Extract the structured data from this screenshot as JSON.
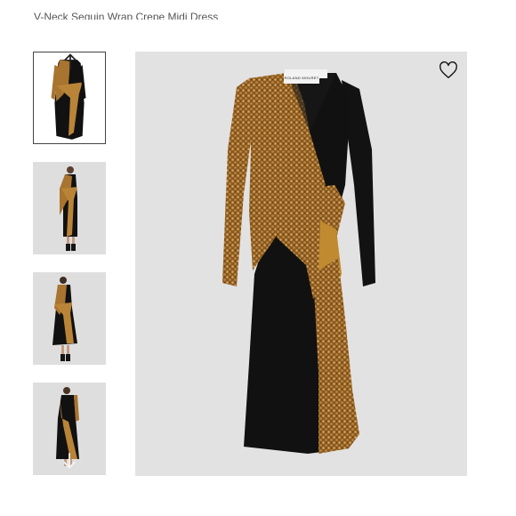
{
  "product": {
    "title": "V-Neck Sequin Wrap Crepe Midi Dress",
    "brand_label": "ROLAND MOURET"
  },
  "gallery": {
    "thumbnail_count": 4,
    "active_index": 0,
    "scroll_up_icon": "arrow-up-icon",
    "scroll_down_icon": "arrow-down-icon"
  },
  "actions": {
    "wishlist_icon": "heart-outline-icon"
  },
  "colors": {
    "sequin_gold": "#a8742f",
    "dress_black": "#111111",
    "backdrop": "#e2e2e2"
  }
}
